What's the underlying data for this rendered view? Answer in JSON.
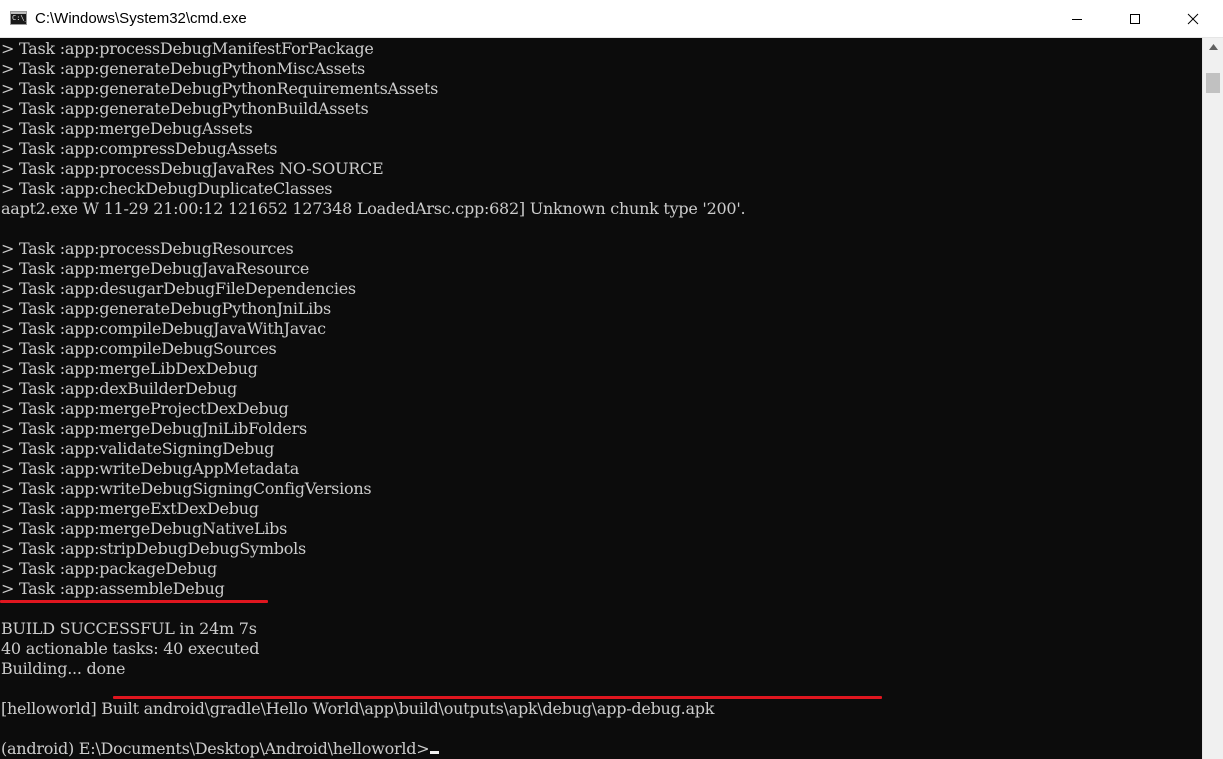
{
  "window": {
    "title": "C:\\Windows\\System32\\cmd.exe",
    "icon_text": "C:\\_",
    "icon": "console-icon",
    "controls": {
      "minimize": "minimize-icon",
      "maximize": "maximize-icon",
      "close": "close-icon"
    }
  },
  "console": {
    "lines": [
      "> Task :app:processDebugManifestForPackage",
      "> Task :app:generateDebugPythonMiscAssets",
      "> Task :app:generateDebugPythonRequirementsAssets",
      "> Task :app:generateDebugPythonBuildAssets",
      "> Task :app:mergeDebugAssets",
      "> Task :app:compressDebugAssets",
      "> Task :app:processDebugJavaRes NO-SOURCE",
      "> Task :app:checkDebugDuplicateClasses",
      "aapt2.exe W 11-29 21:00:12 121652 127348 LoadedArsc.cpp:682] Unknown chunk type '200'.",
      "",
      "> Task :app:processDebugResources",
      "> Task :app:mergeDebugJavaResource",
      "> Task :app:desugarDebugFileDependencies",
      "> Task :app:generateDebugPythonJniLibs",
      "> Task :app:compileDebugJavaWithJavac",
      "> Task :app:compileDebugSources",
      "> Task :app:mergeLibDexDebug",
      "> Task :app:dexBuilderDebug",
      "> Task :app:mergeProjectDexDebug",
      "> Task :app:mergeDebugJniLibFolders",
      "> Task :app:validateSigningDebug",
      "> Task :app:writeDebugAppMetadata",
      "> Task :app:writeDebugSigningConfigVersions",
      "> Task :app:mergeExtDexDebug",
      "> Task :app:mergeDebugNativeLibs",
      "> Task :app:stripDebugDebugSymbols",
      "> Task :app:packageDebug",
      "> Task :app:assembleDebug",
      "",
      "BUILD SUCCESSFUL in 24m 7s",
      "40 actionable tasks: 40 executed",
      "Building... done",
      "",
      "[helloworld] Built android\\gradle\\Hello World\\app\\build\\outputs\\apk\\debug\\app-debug.apk",
      "",
      "(android) E:\\Documents\\Desktop\\Android\\helloworld>"
    ]
  },
  "colors": {
    "console_bg": "#0c0c0c",
    "console_text": "#cccccc",
    "highlight_underline": "#e0161f",
    "titlebar_bg": "#ffffff"
  }
}
